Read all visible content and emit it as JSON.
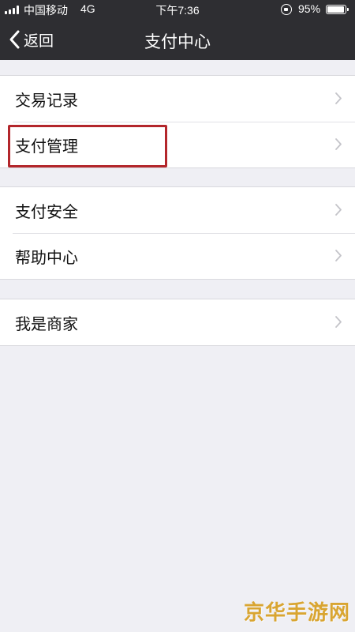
{
  "status_bar": {
    "carrier": "中国移动",
    "network": "4G",
    "time": "下午7:36",
    "battery": "95%"
  },
  "nav": {
    "back_label": "返回",
    "title": "支付中心"
  },
  "groups": [
    {
      "items": [
        {
          "label": "交易记录"
        },
        {
          "label": "支付管理"
        }
      ]
    },
    {
      "items": [
        {
          "label": "支付安全"
        },
        {
          "label": "帮助中心"
        }
      ]
    },
    {
      "items": [
        {
          "label": "我是商家"
        }
      ]
    }
  ],
  "highlighted_item": "支付管理",
  "colors": {
    "nav_background": "#2e2e32",
    "page_background": "#efeff4",
    "highlight_border": "#b3262b",
    "watermark": "#d9a531"
  },
  "icons": [
    "signal-icon",
    "rotation-lock-icon",
    "battery-icon",
    "back-chevron-icon",
    "chevron-right-icon"
  ],
  "watermark": "京华手游网"
}
